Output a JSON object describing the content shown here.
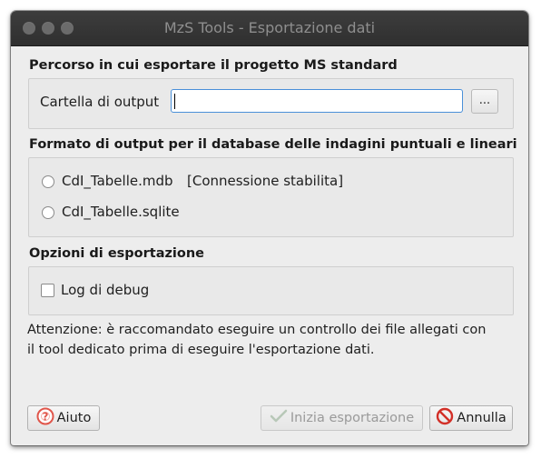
{
  "window": {
    "title": "MzS Tools - Esportazione dati"
  },
  "output_path_group": {
    "title": "Percorso in cui esportare il progetto MS standard",
    "folder_label": "Cartella di output",
    "folder_value": "",
    "browse_label": "..."
  },
  "format_group": {
    "title": "Formato di output per il database delle indagini puntuali e lineari",
    "options": [
      {
        "label": "CdI_Tabelle.mdb",
        "note": "[Connessione stabilita]",
        "selected": false
      },
      {
        "label": "CdI_Tabelle.sqlite",
        "note": "",
        "selected": false
      }
    ]
  },
  "export_options_group": {
    "title": "Opzioni di esportazione",
    "debug_log_label": "Log di debug",
    "debug_log_checked": false
  },
  "warning": {
    "line1": "Attenzione: è raccomandato eseguire un controllo dei file allegati con",
    "line2": "il tool dedicato prima di eseguire l'esportazione dati."
  },
  "buttons": {
    "help_label": "Aiuto",
    "start_label": "Inizia esportazione",
    "cancel_label": "Annulla"
  },
  "icons": {
    "help": "help-icon",
    "start": "check-icon",
    "cancel": "cancel-icon"
  },
  "colors": {
    "focus_border": "#4a90d9",
    "help_icon": "#e0564b",
    "cancel_icon": "#d22f27"
  }
}
